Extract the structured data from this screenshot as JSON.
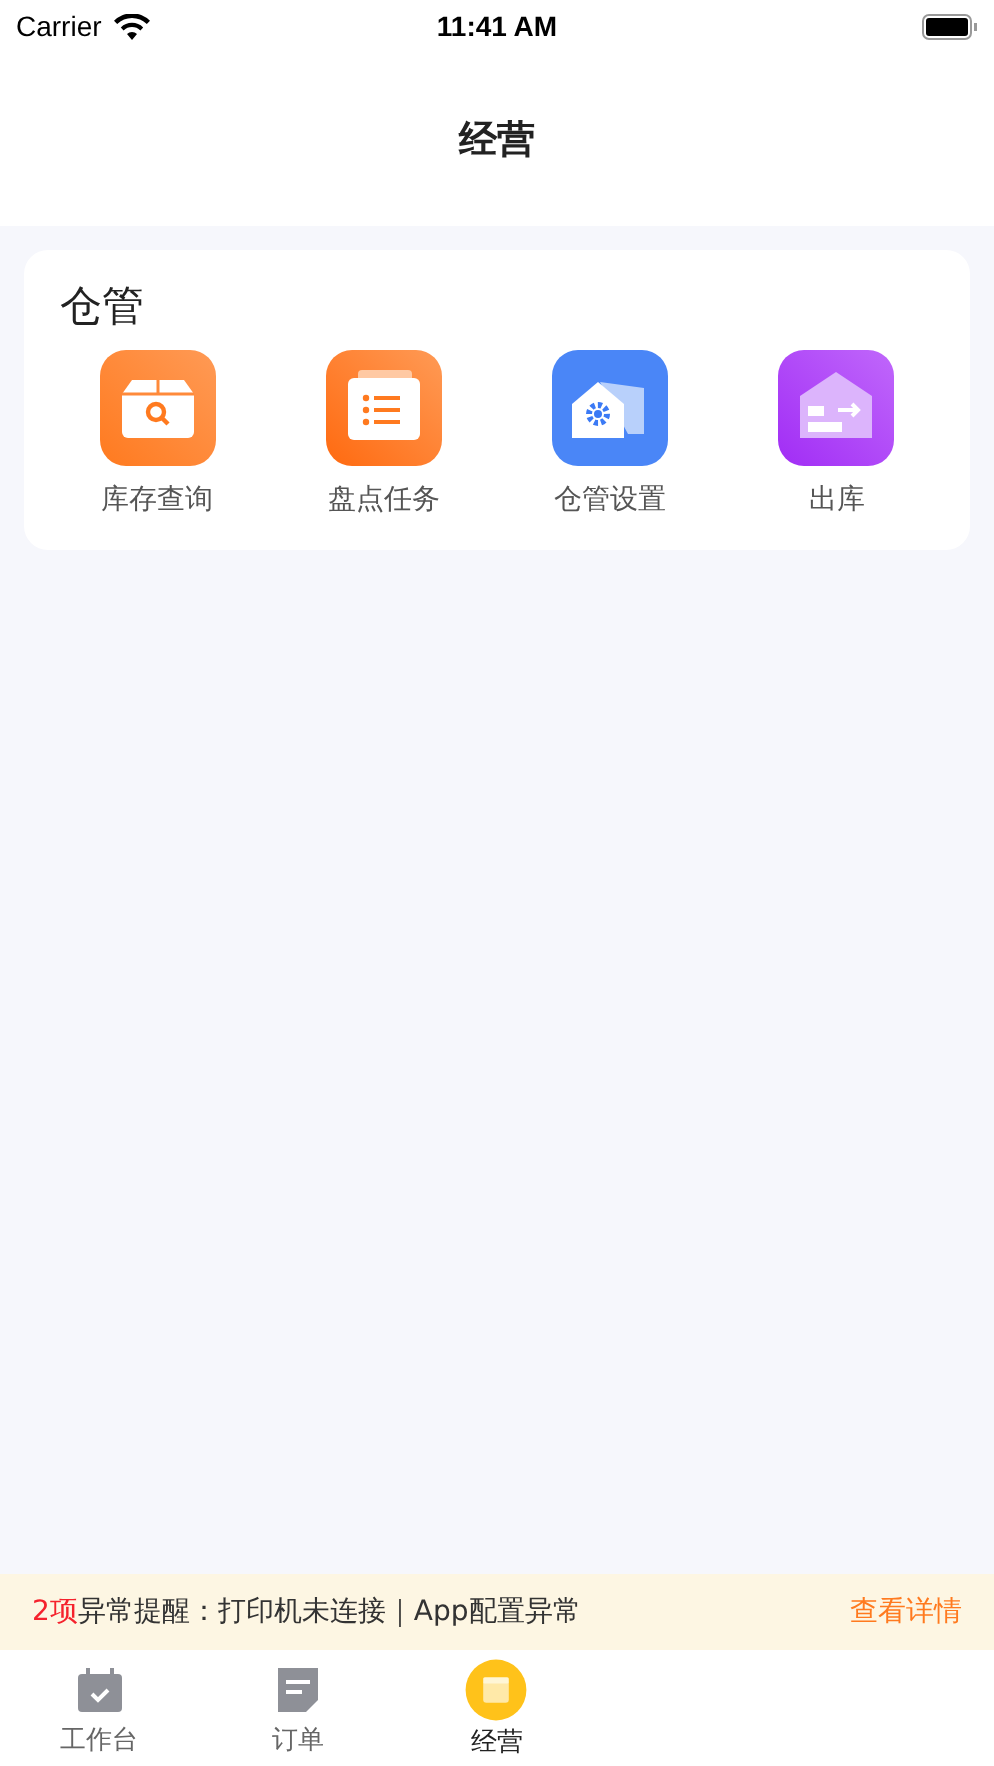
{
  "status_bar": {
    "carrier": "Carrier",
    "time": "11:41 AM"
  },
  "nav": {
    "title": "经营"
  },
  "section": {
    "title": "仓管",
    "items": [
      {
        "kind": "search",
        "label": "库存查询"
      },
      {
        "kind": "list",
        "label": "盘点任务"
      },
      {
        "kind": "settings",
        "label": "仓管设置"
      },
      {
        "kind": "outbound",
        "label": "出库"
      }
    ]
  },
  "alert": {
    "count": "2项",
    "message": "异常提醒：打印机未连接｜App配置异常",
    "link": "查看详情"
  },
  "tabs": [
    {
      "kind": "calendar",
      "label": "工作台",
      "selected": false
    },
    {
      "kind": "note",
      "label": "订单",
      "selected": false
    },
    {
      "kind": "shop",
      "label": "经营",
      "selected": true
    }
  ]
}
